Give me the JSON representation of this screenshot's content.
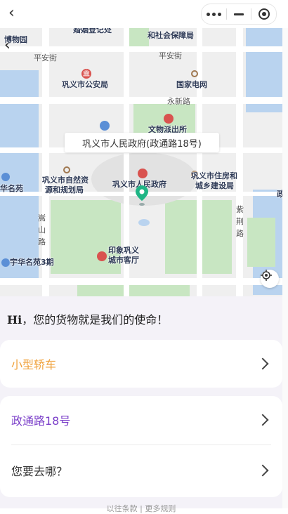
{
  "nav": {
    "back": "<",
    "menu_icon": "more-dots-icon",
    "minimize_icon": "minimize-icon",
    "close_icon": "target-close-icon"
  },
  "map": {
    "callout": "巩义市人民政府(政通路18号)",
    "places": {
      "marriage": "婚姻登记处",
      "social_security": "和社会保障局",
      "museum": "博物园",
      "police": "巩义市公安局",
      "grid": "国家电网",
      "station": "文物派出所",
      "gov": "巩义市人民政府",
      "resources_1": "巩义市自然资",
      "resources_2": "源和规划局",
      "housing_1": "巩义市住房和",
      "housing_2": "城乡建设局",
      "huaming": "华名苑",
      "yuhua": "宇华名苑3期",
      "guest_1": "印象巩义",
      "guest_2": "城市客厅",
      "zheng": "政"
    },
    "roads": {
      "pingan_left": "平安街",
      "pingan_right": "平安街",
      "yongxin": "永新路",
      "songshan_1": "嵩",
      "songshan_2": "山",
      "songshan_3": "路",
      "zijing_1": "紫",
      "zijing_2": "荆",
      "zijing_3": "路"
    }
  },
  "panel": {
    "greeting_hi": "Hi",
    "greeting_rest": "，您的货物就是我们的使命！",
    "vehicle": "小型轿车",
    "from": "政通路18号",
    "to": "您要去哪？",
    "footer": "以往条款 | 更多规则"
  },
  "colors": {
    "vehicle": "#f0a13a",
    "from": "#7b3fc9",
    "to": "#333333",
    "pin": "#1fb585",
    "poi": "#d9534f",
    "park": "#c8e6c2",
    "water": "#b9d3ef",
    "road": "#ffffff"
  }
}
